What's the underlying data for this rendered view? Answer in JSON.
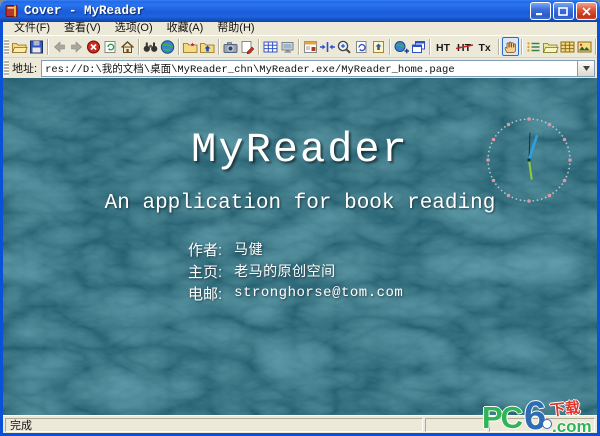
{
  "window": {
    "title": "Cover - MyReader",
    "controls": {
      "minimize": "minimize",
      "maximize": "maximize",
      "close": "close"
    }
  },
  "menu": {
    "items": [
      {
        "name": "menu-file",
        "label": "文件(F)"
      },
      {
        "name": "menu-view",
        "label": "查看(V)"
      },
      {
        "name": "menu-options",
        "label": "选项(O)"
      },
      {
        "name": "menu-favorites",
        "label": "收藏(A)"
      },
      {
        "name": "menu-help",
        "label": "帮助(H)"
      }
    ]
  },
  "toolbar": {
    "items": [
      {
        "name": "open-button",
        "icon": "folder-open"
      },
      {
        "name": "save-button",
        "icon": "floppy"
      },
      {
        "icon": "separator"
      },
      {
        "name": "back-button",
        "icon": "arrow-left",
        "disabled": true
      },
      {
        "name": "forward-button",
        "icon": "arrow-right",
        "disabled": true
      },
      {
        "name": "stop-button",
        "icon": "stop"
      },
      {
        "name": "refresh-button",
        "icon": "refresh"
      },
      {
        "name": "home-button",
        "icon": "home"
      },
      {
        "icon": "separator"
      },
      {
        "name": "search-button",
        "icon": "binoculars"
      },
      {
        "name": "browser-button",
        "icon": "globe"
      },
      {
        "icon": "separator"
      },
      {
        "name": "favorites-folder-button",
        "icon": "folder-star"
      },
      {
        "name": "folder-up-button",
        "icon": "folder-up"
      },
      {
        "icon": "separator"
      },
      {
        "name": "snapshot-button",
        "icon": "camera"
      },
      {
        "name": "edit-image-button",
        "icon": "page-pen"
      },
      {
        "icon": "separator"
      },
      {
        "name": "table-view-button",
        "icon": "table"
      },
      {
        "name": "monitor-view-button",
        "icon": "monitor"
      },
      {
        "icon": "separator"
      },
      {
        "name": "page-layout-button",
        "icon": "page-layout"
      },
      {
        "name": "fit-width-button",
        "icon": "fit-width"
      },
      {
        "name": "zoom-button",
        "icon": "magnifier"
      },
      {
        "name": "rotate-page-button",
        "icon": "page-rotate"
      },
      {
        "name": "export-page-button",
        "icon": "page-up"
      },
      {
        "icon": "separator"
      },
      {
        "name": "open-url-button",
        "icon": "globe-plus"
      },
      {
        "name": "cascade-windows-button",
        "icon": "cascade"
      },
      {
        "icon": "separator"
      },
      {
        "name": "html-mode-button",
        "icon": "text-ht",
        "wide": true
      },
      {
        "name": "html-off-button",
        "icon": "text-ht-strike",
        "wide": true
      },
      {
        "name": "text-mode-button",
        "icon": "text-tx",
        "wide": true
      },
      {
        "icon": "separator"
      },
      {
        "name": "hand-tool-button",
        "icon": "hand",
        "active": true
      },
      {
        "icon": "separator"
      },
      {
        "name": "index-list-button",
        "icon": "list"
      },
      {
        "name": "open-book-button",
        "icon": "folder-open2"
      },
      {
        "name": "thumbnails-button",
        "icon": "grid-yellow"
      },
      {
        "name": "image-view-button",
        "icon": "image"
      },
      {
        "icon": "separator"
      },
      {
        "name": "help-button",
        "icon": "question"
      }
    ]
  },
  "addressbar": {
    "label": "地址:",
    "value": "res://D:\\我的文档\\桌面\\MyReader_chn\\MyReader.exe/MyReader_home.page"
  },
  "content": {
    "title": "MyReader",
    "subtitle": "An application for book reading",
    "info": [
      {
        "label": "作者:",
        "value": "马健"
      },
      {
        "label": "主页:",
        "value": "老马的原创空间"
      },
      {
        "label": "电邮:",
        "value": "stronghorse@tom.com"
      }
    ]
  },
  "clock": {
    "minute_dot_color": "#cfd9de",
    "hour_dot_color": "#e59aa8",
    "hands": {
      "second_deg": 2,
      "second_color": "#12323d",
      "minute_deg": 18,
      "minute_color": "#2FA0DE",
      "third_deg": 172,
      "third_color": "#8FCB3A"
    }
  },
  "statusbar": {
    "panels": [
      "完成",
      "",
      ""
    ]
  },
  "watermark": {
    "pc": "PC",
    "six": "6",
    "dotcom": ".com",
    "badge_label": "下载"
  },
  "colors": {
    "titlebar_blue": "#1B5CD8",
    "window_border": "#0A51D8",
    "chrome_bg": "#ECE9D8",
    "content_teal": "#10444F",
    "watermark_green": "#2FB457",
    "watermark_blue": "#2E6DB4",
    "watermark_red": "#E0342B"
  }
}
